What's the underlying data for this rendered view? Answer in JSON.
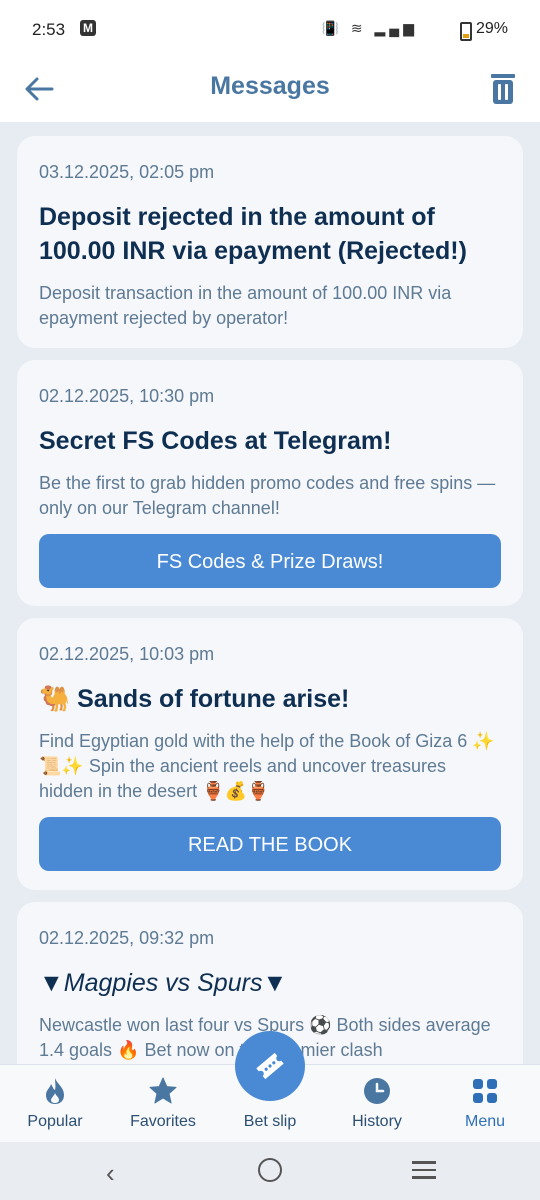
{
  "status_bar": {
    "time": "2:53",
    "carrier_badge": "M",
    "battery": "29%"
  },
  "header": {
    "title": "Messages"
  },
  "messages": [
    {
      "date": "03.12.2025, 02:05 pm",
      "title": "Deposit rejected in the amount of 100.00 INR via epayment (Rejected!)",
      "body": "Deposit transaction in the amount of 100.00 INR via epayment rejected by operator!"
    },
    {
      "date": "02.12.2025, 10:30 pm",
      "title": "Secret FS Codes at Telegram!",
      "body": "Be the first to grab hidden promo codes and free spins — only on our Telegram channel!",
      "button": "FS Codes & Prize Draws!"
    },
    {
      "date": "02.12.2025, 10:03 pm",
      "title": "🐫 Sands of fortune arise!",
      "body": "Find Egyptian gold with the help of the Book of Giza 6 ✨📜✨ Spin the ancient reels and uncover treasures hidden in the desert 🏺💰🏺",
      "button": "READ THE BOOK"
    },
    {
      "date": "02.12.2025, 09:32 pm",
      "title": "▼Magpies vs Spurs▼",
      "body": "Newcastle won last four vs Spurs ⚽ Both sides average 1.4 goals 🔥 Bet now on this Premier clash"
    }
  ],
  "bottom_nav": {
    "items": [
      {
        "label": "Popular",
        "icon": "fire-icon"
      },
      {
        "label": "Favorites",
        "icon": "star-icon"
      },
      {
        "label": "Bet slip",
        "icon": "ticket-icon"
      },
      {
        "label": "History",
        "icon": "clock-icon"
      },
      {
        "label": "Menu",
        "icon": "grid-icon"
      }
    ],
    "active": "Menu"
  },
  "colors": {
    "accent": "#4a8ad4",
    "title": "#4a77a2",
    "text_dark": "#0f2f52",
    "text_muted": "#5e7a94"
  }
}
